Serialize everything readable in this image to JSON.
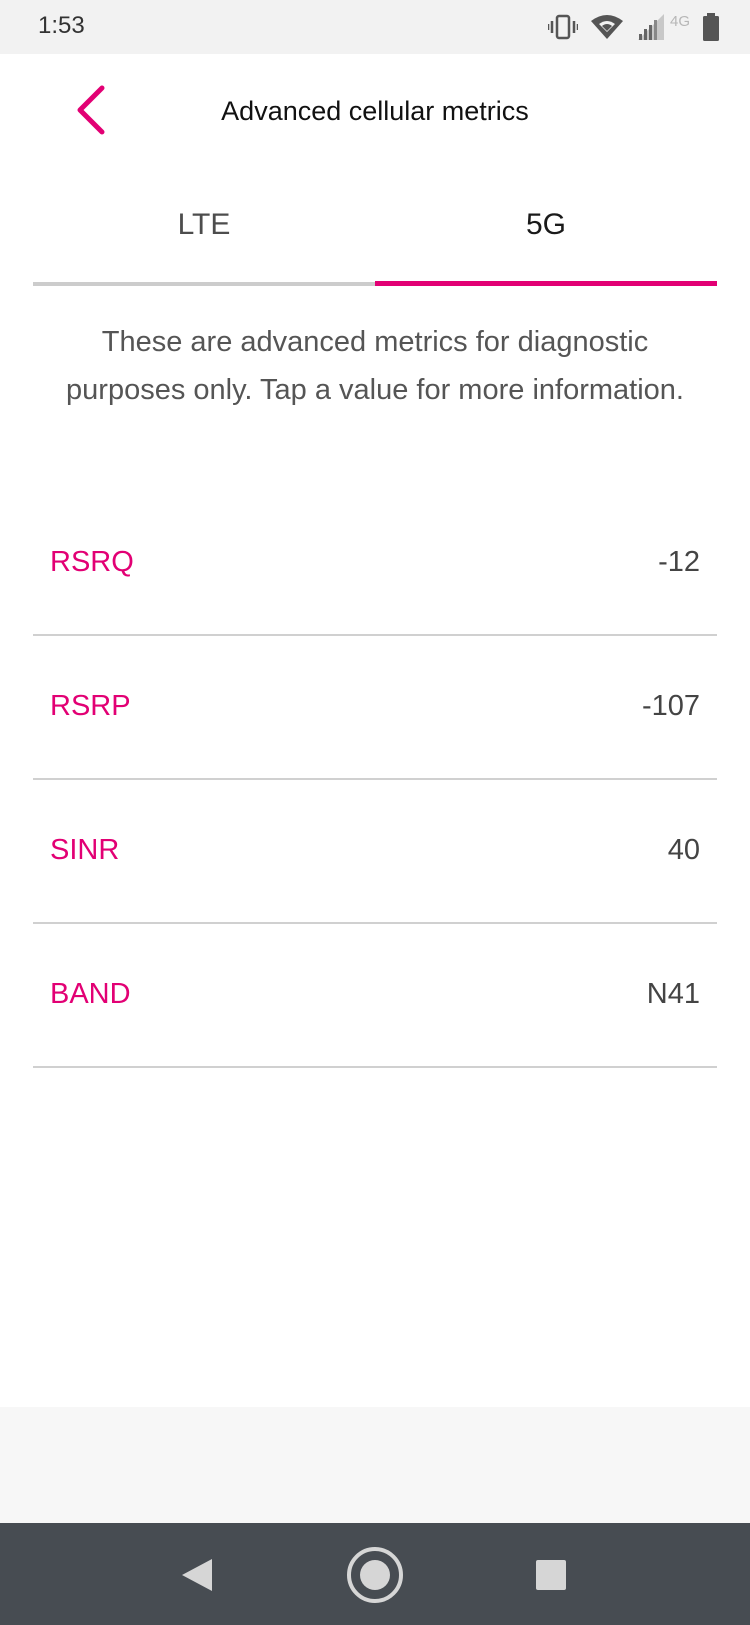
{
  "status_bar": {
    "time": "1:53",
    "network_type": "4G",
    "icons": [
      "vibrate-icon",
      "wifi-icon",
      "cell-signal-icon",
      "battery-icon"
    ]
  },
  "header": {
    "title": "Advanced cellular metrics",
    "back_icon": "chevron-left-icon"
  },
  "tabs": [
    {
      "label": "LTE",
      "selected": false
    },
    {
      "label": "5G",
      "selected": true
    }
  ],
  "description": "These are advanced metrics for diagnostic purposes only. Tap a value for more information.",
  "metrics": [
    {
      "label": "RSRQ",
      "value": "-12"
    },
    {
      "label": "RSRP",
      "value": "-107"
    },
    {
      "label": "SINR",
      "value": "40"
    },
    {
      "label": "BAND",
      "value": "N41"
    }
  ],
  "colors": {
    "accent": "#e20074",
    "nav_bar": "#474c52",
    "status_bar": "#f2f2f2"
  },
  "nav_bar": {
    "icons": [
      "nav-back-icon",
      "nav-home-icon",
      "nav-recent-icon"
    ]
  }
}
